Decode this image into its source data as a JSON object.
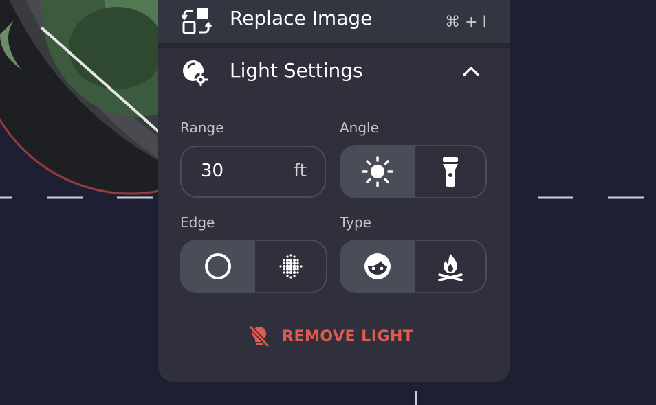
{
  "menu": {
    "replace_image": {
      "label": "Replace Image",
      "shortcut": "⌘ + I",
      "icon": "replace-image-icon"
    },
    "light_settings": {
      "label": "Light Settings",
      "icon": "light-settings-icon",
      "expanded": true
    }
  },
  "light": {
    "range": {
      "label": "Range",
      "value": "30",
      "unit": "ft"
    },
    "angle": {
      "label": "Angle",
      "options": [
        "sun-icon",
        "flashlight-icon"
      ],
      "selected": "sun-icon"
    },
    "edge": {
      "label": "Edge",
      "options": [
        "hard-edge-icon",
        "soft-edge-icon"
      ],
      "selected": "hard-edge-icon"
    },
    "type": {
      "label": "Type",
      "options": [
        "face-icon",
        "campfire-icon"
      ],
      "selected": "face-icon"
    },
    "remove_label": "REMOVE LIGHT"
  },
  "colors": {
    "panel": "#2f303b",
    "background": "#1f1f33",
    "danger": "#e05a4e"
  }
}
